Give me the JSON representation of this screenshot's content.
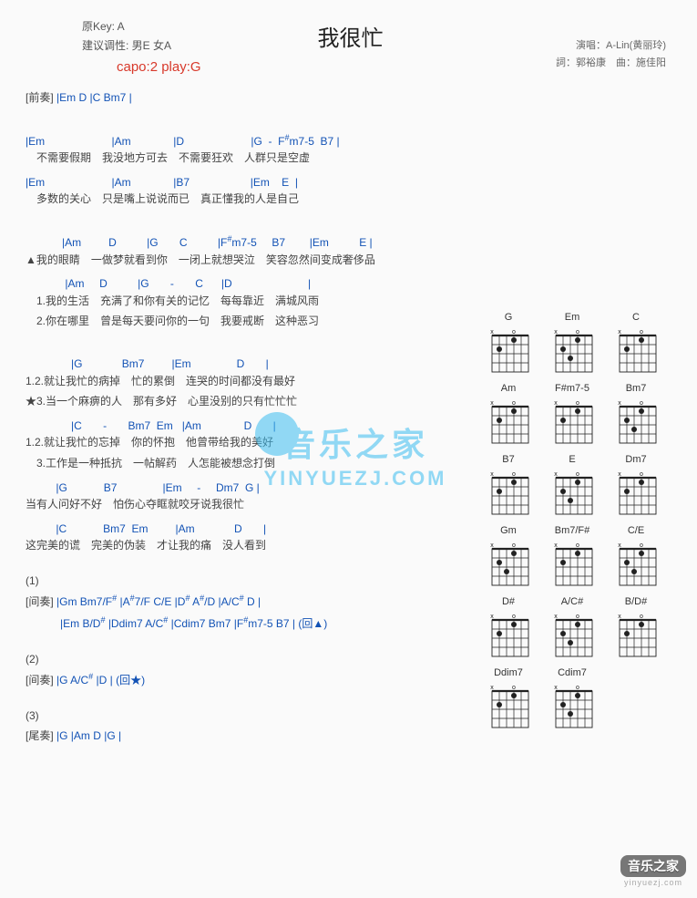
{
  "title": "我很忙",
  "meta_left": {
    "key": "原Key: A",
    "tuning": "建议调性: 男E 女A"
  },
  "meta_right": {
    "singer": "演唱：A-Lin(黄丽玲)",
    "credits": "詞：郭裕康　曲：施佳阳"
  },
  "capo": "capo:2 play:G",
  "intro_label": "[前奏]",
  "intro_chords": "|Em  D   |C  Bm7 |",
  "verse1": {
    "c1": "|Em                      |Am              |D                      |G  -  F",
    "c1b": "m7-5  B7 |",
    "l1": "　不需要假期　我没地方可去　不需要狂欢　人群只是空虚",
    "c2": "|Em                      |Am              |B7                    |Em    E  |",
    "l2": "　多数的关心　只是嘴上说说而已　真正懂我的人是自己"
  },
  "pre1": {
    "c1": "            |Am         D          |G       C          |F",
    "c1b": "m7-5     B7        |Em          E |",
    "l1": "▲我的眼睛　一做梦就看到你　一闭上就想哭泣　笑容忽然间变成奢侈品",
    "c2": "             |Am     D          |G       -       C      |D                         |",
    "l2a": "　1.我的生活　充满了和你有关的记忆　每每靠近　满城风雨",
    "l2b": "　2.你在哪里　曾是每天要问你的一句　我要戒断　这种恶习"
  },
  "chorus": {
    "c1": "               |G             Bm7         |Em               D       |",
    "l1a": "1.2.就让我忙的病掉　忙的累倒　连哭的时间都没有最好",
    "l1b": "★3.当一个麻痹的人　那有多好　心里没别的只有忙忙忙",
    "c2": "               |C       -       Bm7  Em   |Am              D       |",
    "l2a": "1.2.就让我忙的忘掉　你的怀抱　他曾带给我的美好",
    "l2b": "　3.工作是一种抵抗　一帖解药　人怎能被想念打倒",
    "c3": "          |G            B7               |Em     -     Dm7  G |",
    "l3": "当有人问好不好　怕伤心夺眶就咬牙说我很忙",
    "c4": "          |C            Bm7  Em         |Am             D       |",
    "l4": "这完美的谎　完美的伪装　才让我的痛　没人看到"
  },
  "bridge1": {
    "label": "(1)",
    "inter_label": "[间奏]",
    "line1a": "|Gm  Bm7/F",
    "line1b": "   |A",
    "line1c": "7/F   C/E   |D",
    "line1d": "   A",
    "line1e": "/D   |A/C",
    "line1f": "  D  |",
    "line2a": "|Em  B/D",
    "line2b": "    |Ddim7  A/C",
    "line2c": "  |Cdim7  Bm7 |F",
    "line2d": "m7-5  B7 |  (回▲)"
  },
  "bridge2": {
    "label": "(2)",
    "inter_label": "[间奏]",
    "line1a": "|G  A/C",
    "line1b": "   |D      |  (回★)"
  },
  "outro": {
    "label": "(3)",
    "outro_label": "[尾奏]",
    "chords": "|G     |Am  D  |G     |"
  },
  "diagrams": [
    {
      "name": "G"
    },
    {
      "name": "Em"
    },
    {
      "name": "C"
    },
    {
      "name": "Am"
    },
    {
      "name": "F#m7-5"
    },
    {
      "name": "Bm7"
    },
    {
      "name": "B7"
    },
    {
      "name": "E"
    },
    {
      "name": "Dm7"
    },
    {
      "name": "Gm"
    },
    {
      "name": "Bm7/F#"
    },
    {
      "name": "C/E"
    },
    {
      "name": "D#"
    },
    {
      "name": "A/C#"
    },
    {
      "name": "B/D#"
    },
    {
      "name": "Ddim7"
    },
    {
      "name": "Cdim7"
    }
  ],
  "watermark": {
    "cn": "音乐之家",
    "en": "YINYUEZJ.COM"
  },
  "logo": {
    "cn": "音乐之家",
    "en": "yinyuezj.com"
  }
}
